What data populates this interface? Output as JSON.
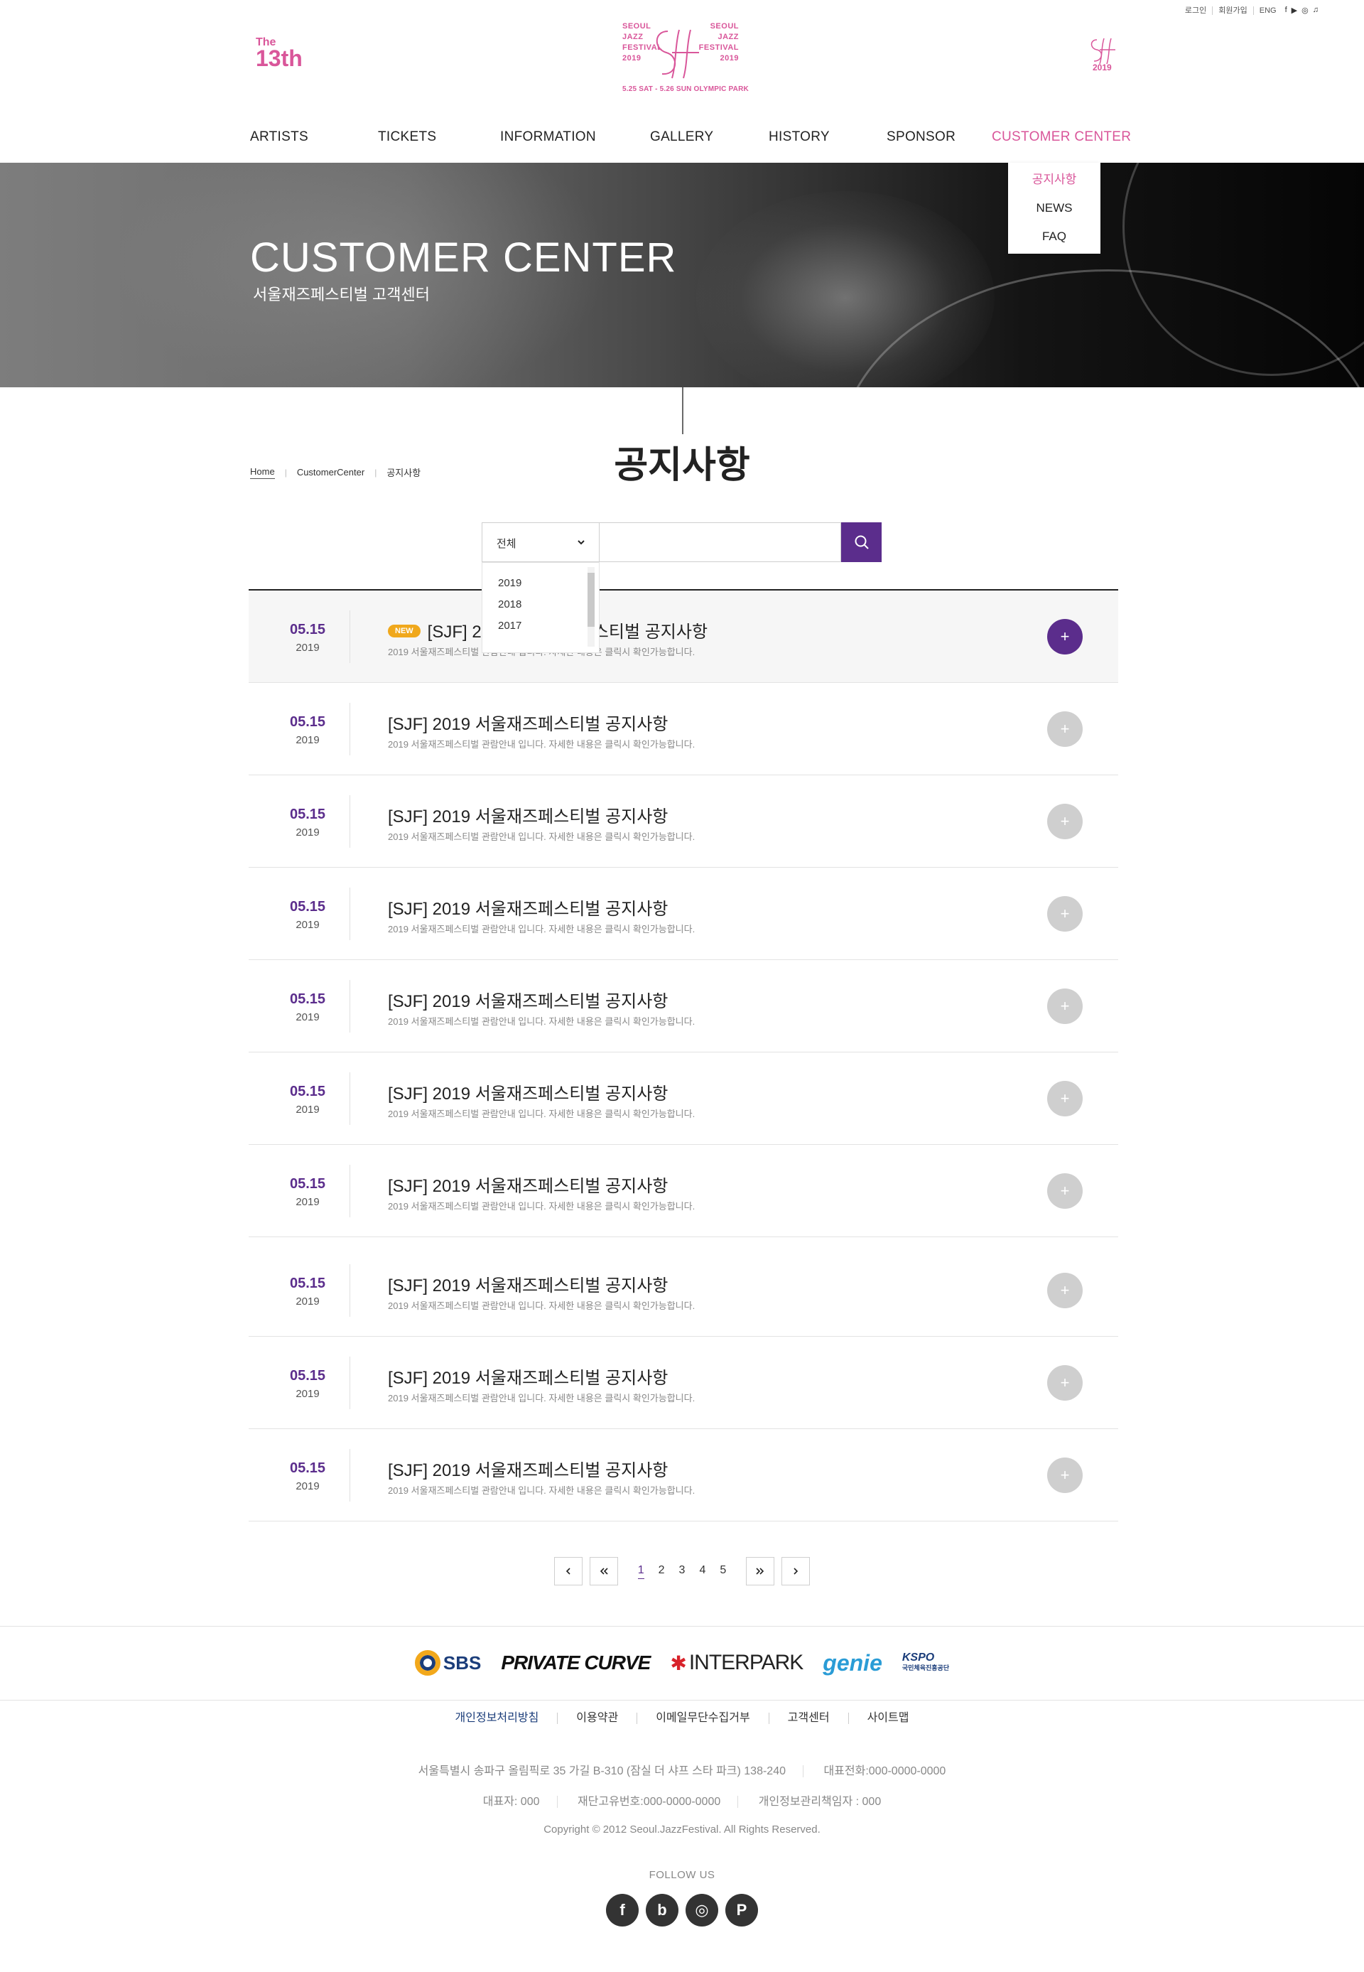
{
  "util": {
    "links": [
      "로그인",
      "회원가입",
      "ENG"
    ],
    "sns_icons": [
      "facebook-icon",
      "youtube-icon",
      "instagram-icon",
      "music-icon"
    ]
  },
  "header": {
    "badge_the": "The",
    "badge_num": "13th",
    "logo_left": [
      "SEOUL",
      "JAZZ",
      "FESTIVAL",
      "2019"
    ],
    "logo_right": [
      "SEOUL",
      "JAZZ",
      "FESTIVAL",
      "2019"
    ],
    "logo_date": "5.25 SAT - 5.26 SUN OLYMPIC PARK",
    "right_mark_year": "2019"
  },
  "nav": {
    "items": [
      "ARTISTS",
      "TICKETS",
      "INFORMATION",
      "GALLERY",
      "HISTORY",
      "SPONSOR",
      "CUSTOMER CENTER"
    ],
    "active": "CUSTOMER CENTER",
    "dropdown": [
      "공지사항",
      "NEWS",
      "FAQ"
    ]
  },
  "hero": {
    "title": "CUSTOMER CENTER",
    "subtitle": "서울재즈페스티벌 고객센터"
  },
  "breadcrumb": [
    "Home",
    "CustomerCenter",
    "공지사항"
  ],
  "page_title": "공지사항",
  "search": {
    "select_value": "전체",
    "options": [
      "2019",
      "2018",
      "2017"
    ],
    "input_value": ""
  },
  "notices": [
    {
      "mday": "05.15",
      "year": "2019",
      "title": "[SJF] 2019 서울재즈페스티벌 공지사항",
      "desc": "2019 서울재즈페스티벌 관람안내 입니다. 자세한 내용은 클릭시 확인가능합니다.",
      "is_new": true,
      "new_label": "NEW"
    },
    {
      "mday": "05.15",
      "year": "2019",
      "title": "[SJF] 2019 서울재즈페스티벌 공지사항",
      "desc": "2019 서울재즈페스티벌 관람안내 입니다. 자세한 내용은 클릭시 확인가능합니다.",
      "is_new": false
    },
    {
      "mday": "05.15",
      "year": "2019",
      "title": "[SJF] 2019 서울재즈페스티벌 공지사항",
      "desc": "2019 서울재즈페스티벌 관람안내 입니다. 자세한 내용은 클릭시 확인가능합니다.",
      "is_new": false
    },
    {
      "mday": "05.15",
      "year": "2019",
      "title": "[SJF] 2019 서울재즈페스티벌 공지사항",
      "desc": "2019 서울재즈페스티벌 관람안내 입니다. 자세한 내용은 클릭시 확인가능합니다.",
      "is_new": false
    },
    {
      "mday": "05.15",
      "year": "2019",
      "title": "[SJF] 2019 서울재즈페스티벌 공지사항",
      "desc": "2019 서울재즈페스티벌 관람안내 입니다. 자세한 내용은 클릭시 확인가능합니다.",
      "is_new": false
    },
    {
      "mday": "05.15",
      "year": "2019",
      "title": "[SJF] 2019 서울재즈페스티벌 공지사항",
      "desc": "2019 서울재즈페스티벌 관람안내 입니다. 자세한 내용은 클릭시 확인가능합니다.",
      "is_new": false
    },
    {
      "mday": "05.15",
      "year": "2019",
      "title": "[SJF] 2019 서울재즈페스티벌 공지사항",
      "desc": "2019 서울재즈페스티벌 관람안내 입니다. 자세한 내용은 클릭시 확인가능합니다.",
      "is_new": false
    },
    {
      "mday": "05.15",
      "year": "2019",
      "title": "[SJF] 2019 서울재즈페스티벌 공지사항",
      "desc": "2019 서울재즈페스티벌 관람안내 입니다. 자세한 내용은 클릭시 확인가능합니다.",
      "is_new": false
    },
    {
      "mday": "05.15",
      "year": "2019",
      "title": "[SJF] 2019 서울재즈페스티벌 공지사항",
      "desc": "2019 서울재즈페스티벌 관람안내 입니다. 자세한 내용은 클릭시 확인가능합니다.",
      "is_new": false
    },
    {
      "mday": "05.15",
      "year": "2019",
      "title": "[SJF] 2019 서울재즈페스티벌 공지사항",
      "desc": "2019 서울재즈페스티벌 관람안내 입니다. 자세한 내용은 클릭시 확인가능합니다.",
      "is_new": false
    }
  ],
  "pagination": {
    "pages": [
      "1",
      "2",
      "3",
      "4",
      "5"
    ],
    "current": "1"
  },
  "footer": {
    "sponsors": {
      "sbs": "SBS",
      "private_curve": "PRIVATE CURVE",
      "interpark": "INTERPARK",
      "genie": "genie",
      "kspo": "KSPO",
      "kspo_sub": "국민체육진흥공단"
    },
    "links": [
      "개인정보처리방침",
      "이용약관",
      "이메일무단수집거부",
      "고객센터",
      "사이트맵"
    ],
    "address": "서울특별시 송파구 올림픽로 35 가길 B-310 (잠실 더 샤프 스타 파크) 138-240",
    "tel": "대표전화:000-0000-0000",
    "ceo": "대표자: 000",
    "biz_no": "재단고유번호:000-0000-0000",
    "privacy_officer": "개인정보관리책임자 : 000",
    "copyright": "Copyright © 2012 Seoul.JazzFestival. All Rights Reserved.",
    "follow_label": "FOLLOW US",
    "social": [
      "f",
      "b",
      "◎",
      "P"
    ]
  },
  "colors": {
    "brand_pink": "#d9569a",
    "brand_purple": "#5b2d8c",
    "new_badge": "#f0a81c"
  }
}
